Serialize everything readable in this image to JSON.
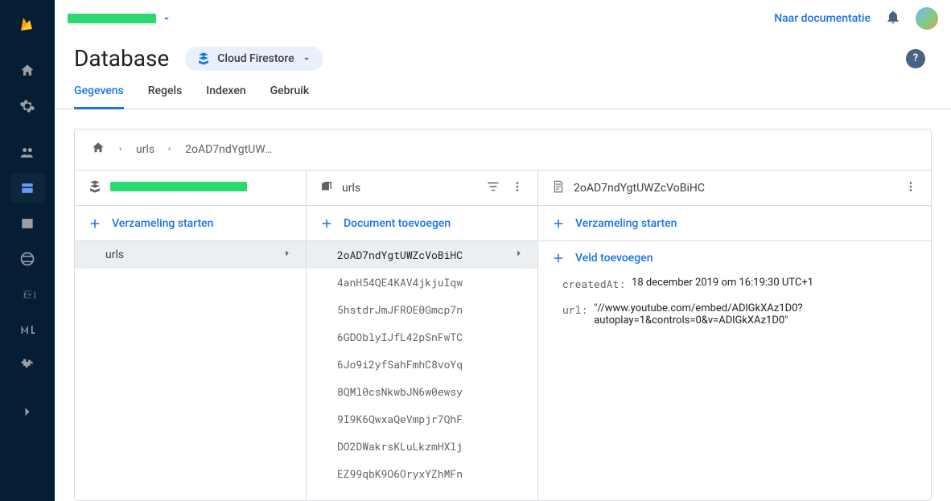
{
  "header": {
    "doc_link": "Naar documentatie"
  },
  "title": "Database",
  "db_select_label": "Cloud Firestore",
  "tabs": [
    {
      "label": "Gegevens",
      "active": true
    },
    {
      "label": "Regels",
      "active": false
    },
    {
      "label": "Indexen",
      "active": false
    },
    {
      "label": "Gebruik",
      "active": false
    }
  ],
  "breadcrumb": {
    "collection": "urls",
    "document": "2oAD7ndYgtUW…"
  },
  "root_col": {
    "action_label": "Verzameling starten",
    "items": [
      {
        "label": "urls",
        "selected": true
      }
    ]
  },
  "docs_col": {
    "title": "urls",
    "action_label": "Document toevoegen",
    "items": [
      {
        "id": "2oAD7ndYgtUWZcVoBiHC",
        "selected": true
      },
      {
        "id": "4anH54QE4KAV4jkjuIqw"
      },
      {
        "id": "5hstdrJmJFROE0Gmcp7n"
      },
      {
        "id": "6GDOblyIJfL42pSnFwTC"
      },
      {
        "id": "6Jo9i2yfSahFmhC8voYq"
      },
      {
        "id": "8QMl0csNkwbJN6w0ewsy"
      },
      {
        "id": "9I9K6QwxaQeVmpjr7QhF"
      },
      {
        "id": "DO2DWakrsKLuLkzmHXlj"
      },
      {
        "id": "EZ99qbK9O6OryxYZhMFn"
      }
    ]
  },
  "detail_col": {
    "title": "2oAD7ndYgtUWZcVoBiHC",
    "action_label": "Verzameling starten",
    "add_field_label": "Veld toevoegen",
    "fields": {
      "createdAt": {
        "key": "createdAt",
        "value": "18 december 2019 om 16:19:30 UTC+1",
        "is_string": false
      },
      "url": {
        "key": "url",
        "value": "//www.youtube.com/embed/ADlGkXAz1D0?autoplay=1&controls=0&v=ADlGkXAz1D0",
        "is_string": true
      }
    }
  }
}
